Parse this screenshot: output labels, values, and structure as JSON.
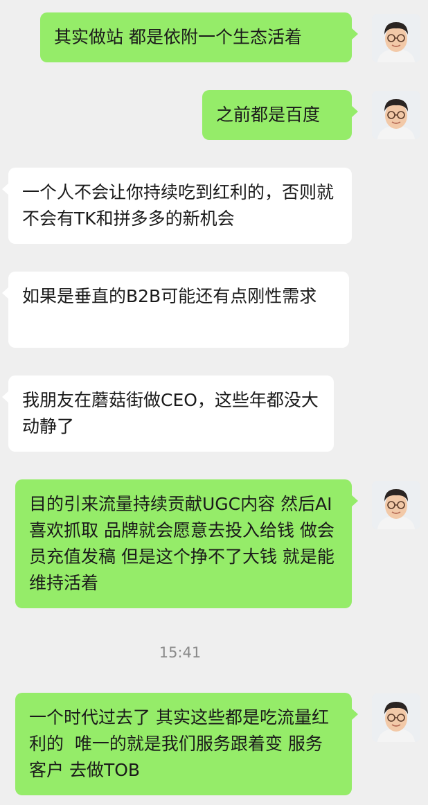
{
  "messages": [
    {
      "id": "m1",
      "direction": "out",
      "text": "其实做站 都是依附一个生态活着"
    },
    {
      "id": "m2",
      "direction": "out",
      "text": "之前都是百度"
    },
    {
      "id": "m3",
      "direction": "in",
      "text": "一个人不会让你持续吃到红利的，否则就不会有TK和拼多多的新机会"
    },
    {
      "id": "m4",
      "direction": "in",
      "text": "如果是垂直的B2B可能还有点刚性需求"
    },
    {
      "id": "m5",
      "direction": "in",
      "text": "我朋友在蘑菇街做CEO，这些年都没大动静了"
    },
    {
      "id": "m6",
      "direction": "out",
      "text": "目的引来流量持续贡献UGC内容 然后AI喜欢抓取 品牌就会愿意去投入给钱 做会员充值发稿 但是这个挣不了大钱 就是能维持活着"
    },
    {
      "id": "m7",
      "direction": "out",
      "text": "一个时代过去了 其实这些都是吃流量红利的  唯一的就是我们服务跟着变 服务客户 去做TOB"
    }
  ],
  "timestamp": "15:41",
  "colors": {
    "background": "#efefef",
    "outgoing_bubble": "#95ec69",
    "incoming_bubble": "#ffffff",
    "text": "#1a1a1a",
    "timestamp": "#8a8a8a"
  }
}
